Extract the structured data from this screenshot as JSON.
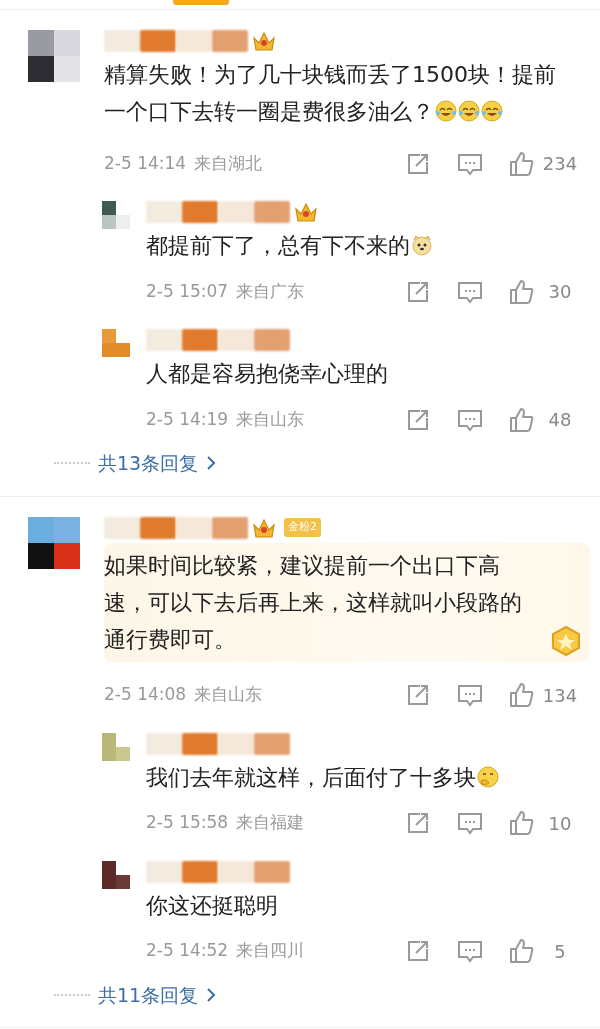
{
  "comments": [
    {
      "badge": {
        "kind": "crown"
      },
      "featured": false,
      "text": "精算失败！为了几十块钱而丢了1500块！提前一个口下去转一圈是费很多油么？",
      "emojis": [
        {
          "kind": "laughing"
        },
        {
          "kind": "laughing"
        },
        {
          "kind": "laughing"
        }
      ],
      "time": "2-5 14:14",
      "location": "来自湖北",
      "likes": "234",
      "replies": [
        {
          "badge": {
            "kind": "crown"
          },
          "text": "都提前下了，总有下不来的",
          "emojis": [
            {
              "kind": "dog"
            }
          ],
          "time": "2-5 15:07",
          "location": "来自广东",
          "likes": "30"
        },
        {
          "text": "人都是容易抱侥幸心理的",
          "time": "2-5 14:19",
          "location": "来自山东",
          "likes": "48"
        }
      ],
      "more_replies": "共13条回复"
    },
    {
      "badge": {
        "kind": "crown",
        "label": "金粉2"
      },
      "featured": true,
      "text": "如果时间比较紧，建议提前一个出口下高速，可以下去后再上来，这样就叫小段路的通行费即可。",
      "time": "2-5 14:08",
      "location": "来自山东",
      "likes": "134",
      "replies": [
        {
          "text": "我们去年就这样，后面付了十多块",
          "emojis": [
            {
              "kind": "thinking"
            }
          ],
          "time": "2-5 15:58",
          "location": "来自福建",
          "likes": "10"
        },
        {
          "text": "你这还挺聪明",
          "time": "2-5 14:52",
          "location": "来自四川",
          "likes": "5"
        }
      ],
      "more_replies": "共11条回复"
    }
  ]
}
